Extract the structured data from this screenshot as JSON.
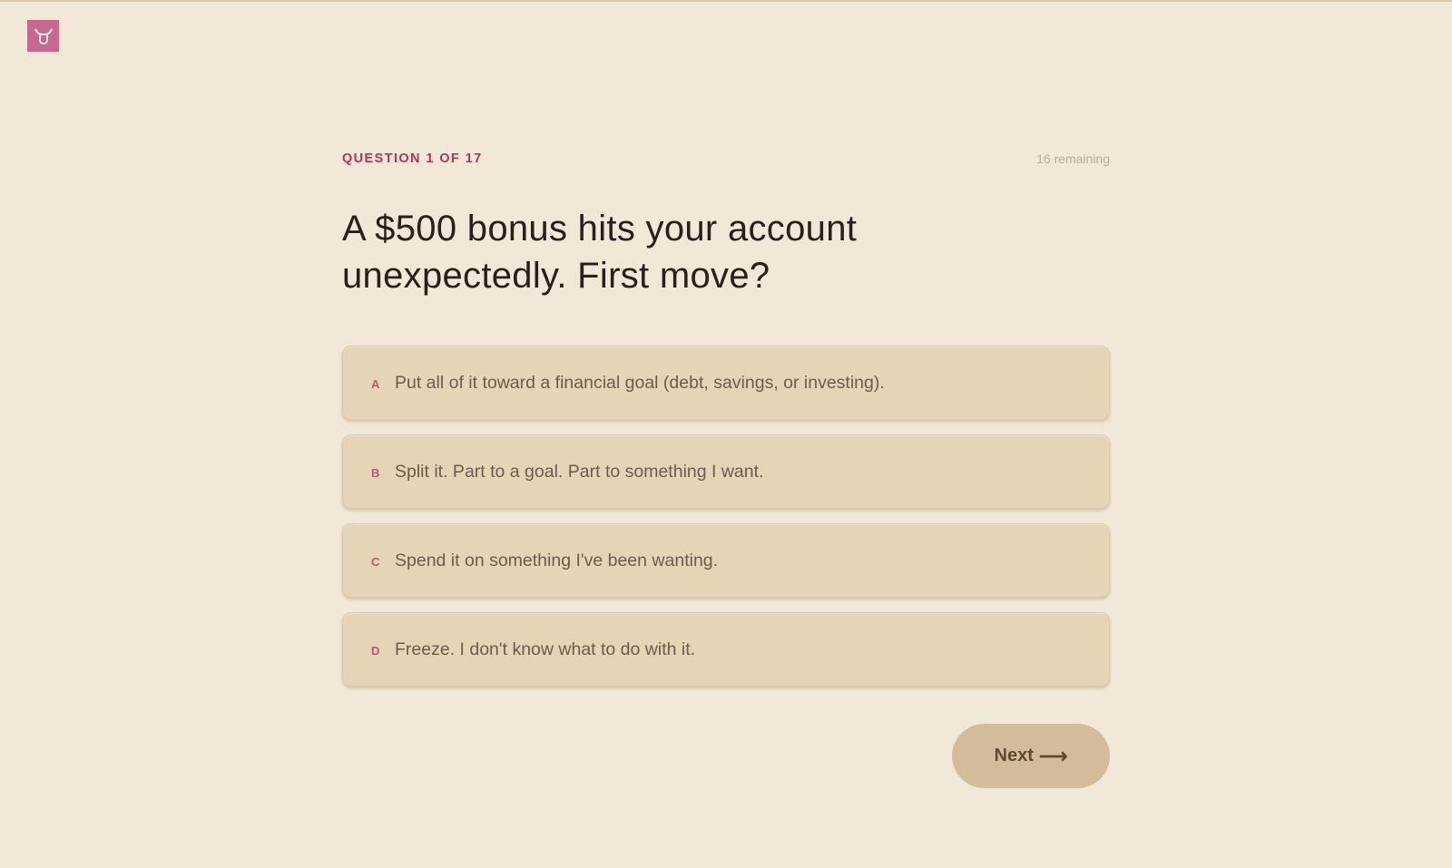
{
  "brand": {
    "logo_icon": "bull-horns-icon",
    "logo_color": "#c7698d"
  },
  "quiz": {
    "progress_label": "QUESTION 1 OF 17",
    "remaining_label": "16 remaining",
    "question": "A $500 bonus hits your account unexpectedly. First move?",
    "options": [
      {
        "letter": "A",
        "text": "Put all of it toward a financial goal (debt, savings, or investing)."
      },
      {
        "letter": "B",
        "text": "Split it. Part to a goal. Part to something I want."
      },
      {
        "letter": "C",
        "text": "Spend it on something I've been wanting."
      },
      {
        "letter": "D",
        "text": "Freeze. I don't know what to do with it."
      }
    ],
    "next_label": "Next",
    "next_arrow": "⟶"
  },
  "colors": {
    "background": "#f2e8d7",
    "accent": "#b3345c",
    "option_bg": "#e5d5b7",
    "button_bg": "#d2bc9b"
  }
}
